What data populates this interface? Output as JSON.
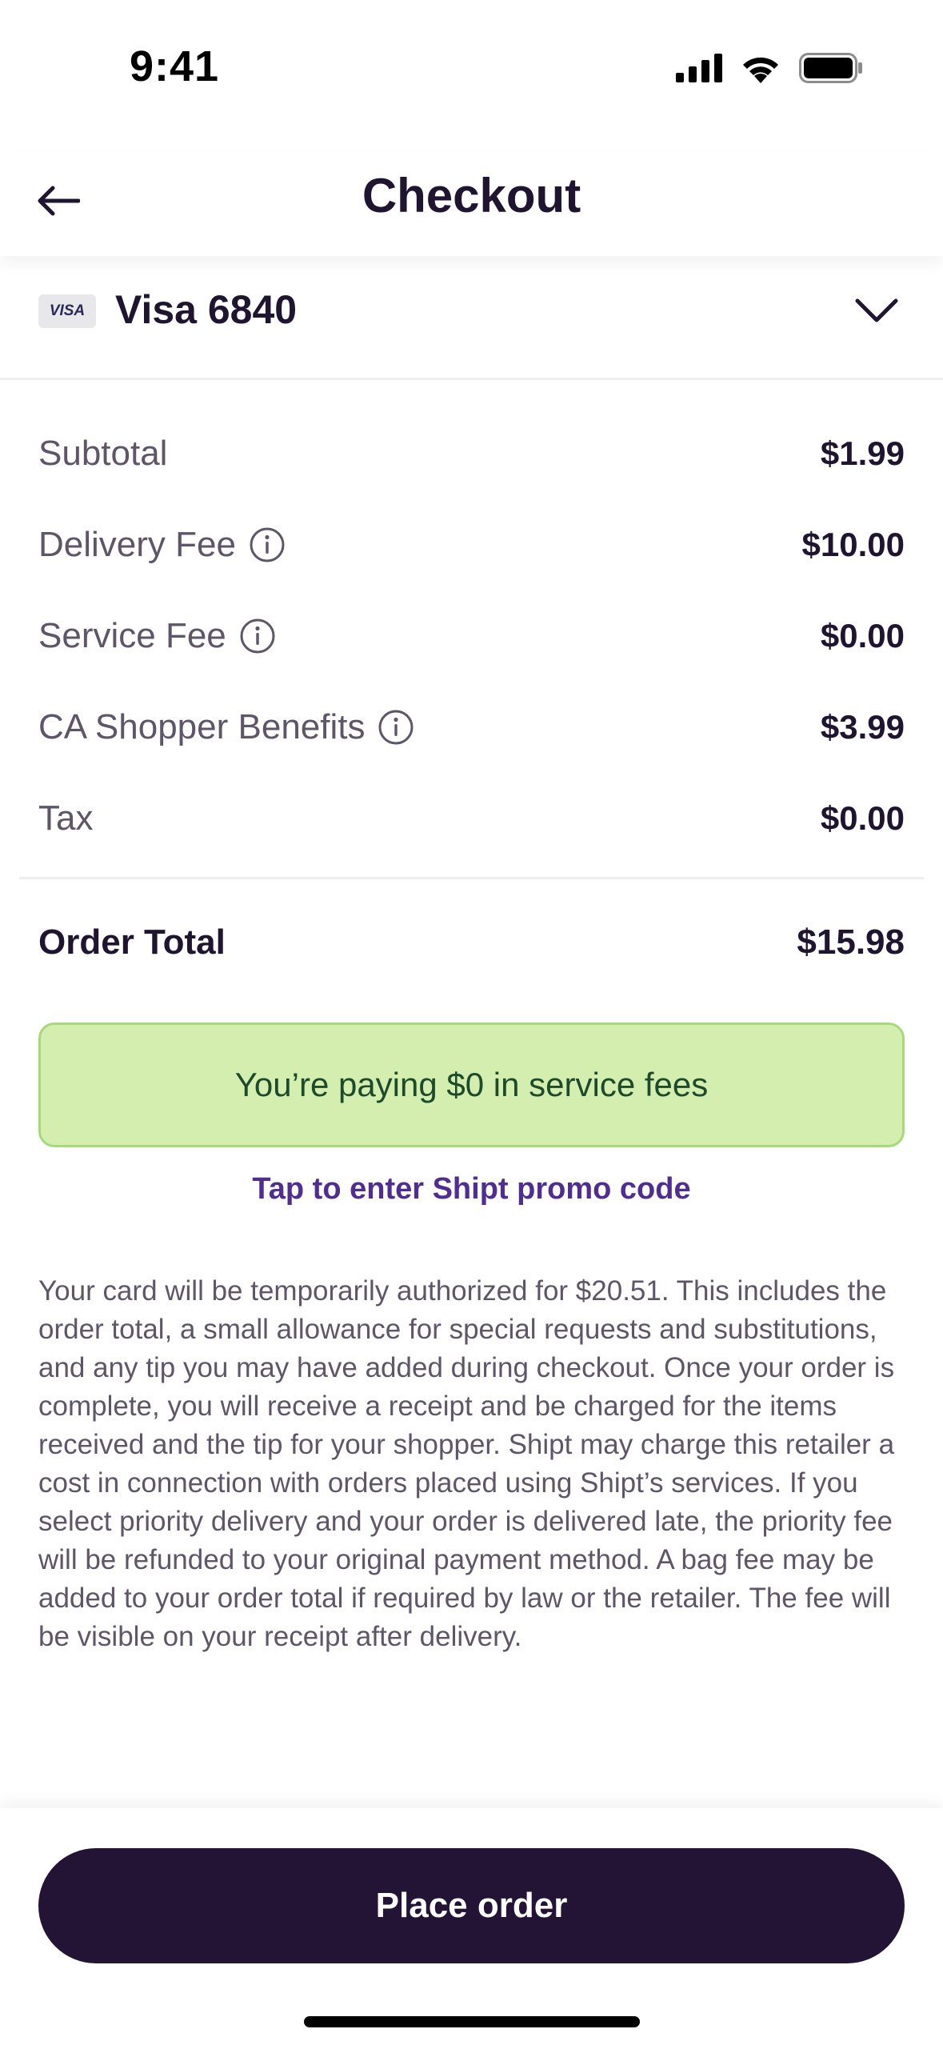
{
  "status_bar": {
    "time": "9:41",
    "icons": [
      "cellular-signal-icon",
      "wifi-icon",
      "battery-icon"
    ]
  },
  "header": {
    "title": "Checkout",
    "back_icon": "arrow-left-icon"
  },
  "payment": {
    "card_brand": "VISA",
    "card_label": "Visa 6840",
    "expand_icon": "chevron-down-icon"
  },
  "line_items": [
    {
      "label": "Subtotal",
      "value": "$1.99",
      "info": false
    },
    {
      "label": "Delivery Fee",
      "value": "$10.00",
      "info": true
    },
    {
      "label": "Service Fee",
      "value": "$0.00",
      "info": true
    },
    {
      "label": "CA Shopper Benefits",
      "value": "$3.99",
      "info": true
    },
    {
      "label": "Tax",
      "value": "$0.00",
      "info": false
    }
  ],
  "total": {
    "label": "Order Total",
    "value": "$15.98"
  },
  "savings_banner": "You’re paying $0 in service fees",
  "promo_link": "Tap to enter Shipt promo code",
  "disclaimer": "Your card will be temporarily authorized for $20.51. This includes the order total, a small allowance for special requests and substitutions, and any tip you may have added during checkout. Once your order is complete, you will receive a receipt and be charged for the items received and the tip for your shopper. Shipt may charge this retailer a cost in connection with orders placed using Shipt’s services. If you select priority delivery and your order is delivered late, the priority fee will be refunded to your original payment method. A bag fee may be added to your order total if required by law or the retailer. The fee will be visible on your receipt after delivery.",
  "place_order_label": "Place order",
  "colors": {
    "brand_dark": "#231436",
    "accent_purple": "#502d91",
    "banner_bg": "#d4eeb0",
    "banner_border": "#a6d97a",
    "banner_text": "#1d4a2a"
  }
}
